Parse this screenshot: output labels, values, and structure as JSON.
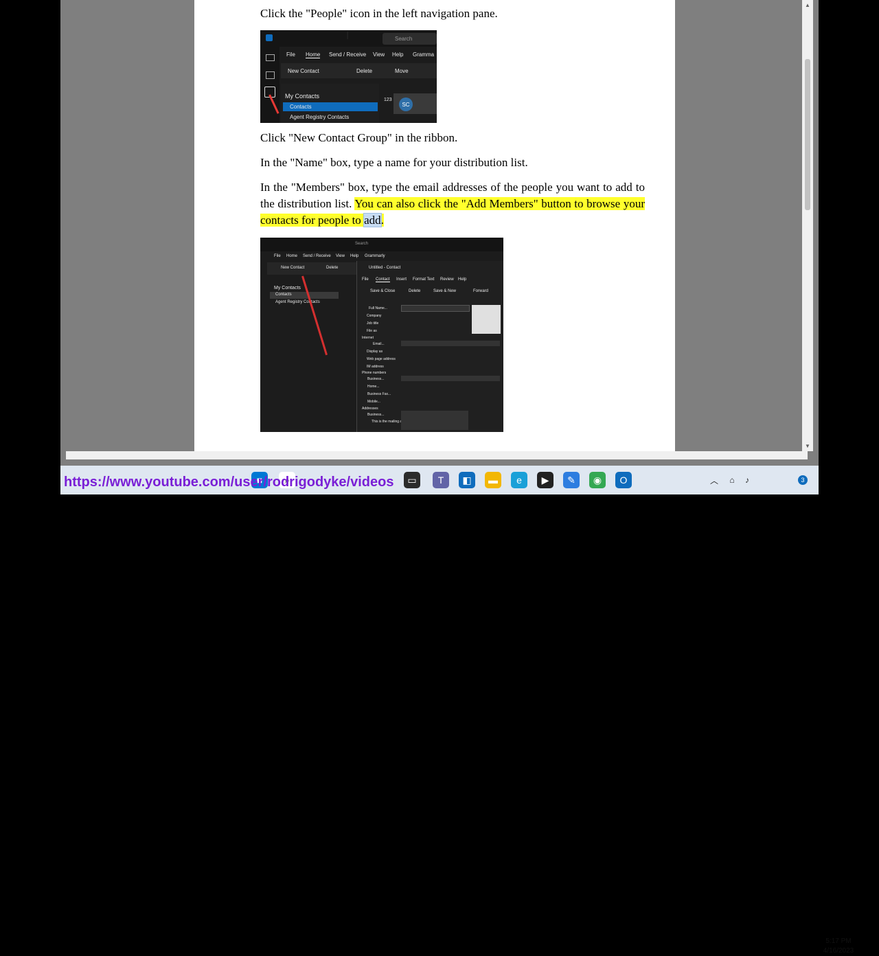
{
  "document": {
    "step1": "Click the \"People\" icon in the left navigation pane.",
    "step2": "Click \"New Contact Group\" in the ribbon.",
    "step3": "In the \"Name\" box, type a name for your distribution list.",
    "step4_plain": "In the \"Members\" box, type the email addresses of the people you want to add to the distribution list. ",
    "step4_highlight": "You can also click the \"Add Members\" button to browse your contacts for people to ",
    "step4_selected": "add",
    "step4_end": "."
  },
  "screenshot1": {
    "search": "Search",
    "menu": [
      "File",
      "Home",
      "Send / Receive",
      "View",
      "Help",
      "Gramma"
    ],
    "new_contact": "New Contact",
    "delete": "Delete",
    "move": "Move",
    "my_contacts": "My Contacts",
    "contacts": "Contacts",
    "agent_registry": "Agent Registry Contacts",
    "index": "123",
    "avatar_initials": "SC"
  },
  "screenshot2": {
    "search": "Search",
    "menu": [
      "File",
      "Home",
      "Send / Receive",
      "View",
      "Help",
      "Grammarly"
    ],
    "new_contact": "New Contact",
    "delete": "Delete",
    "my_contacts": "My Contacts",
    "contacts": "Contacts",
    "agent_registry": "Agent Registry Contacts",
    "window_title": "Untitled - Contact",
    "contact_tabs": [
      "File",
      "Contact",
      "Insert",
      "Format Text",
      "Review",
      "Help"
    ],
    "save_close": "Save & Close",
    "delete2": "Delete",
    "save_new": "Save & New",
    "forward": "Forward",
    "full_name": "Full Name...",
    "company": "Company",
    "job_title": "Job title",
    "file_as": "File as",
    "internet": "Internet",
    "email": "Email...",
    "display_as": "Display as",
    "web_page": "Web page address",
    "im_address": "IM address",
    "phone_numbers": "Phone numbers",
    "business": "Business...",
    "home": "Home...",
    "business_fax": "Business Fax...",
    "mobile": "Mobile...",
    "addresses": "Addresses",
    "business2": "Business...",
    "mailing": "This is the mailing address"
  },
  "overlay": {
    "youtube_url": "https://www.youtube.com/user/rodrigodyke/videos"
  },
  "taskbar": {
    "time": "5:17 PM",
    "date": "4/16/2023",
    "notification_count": "3"
  },
  "colors": {
    "highlight": "#ffff2d",
    "taskbar_bg": "#dfe7f1",
    "link": "#7a1fd6",
    "outlook_blue": "#0f6cbd"
  }
}
